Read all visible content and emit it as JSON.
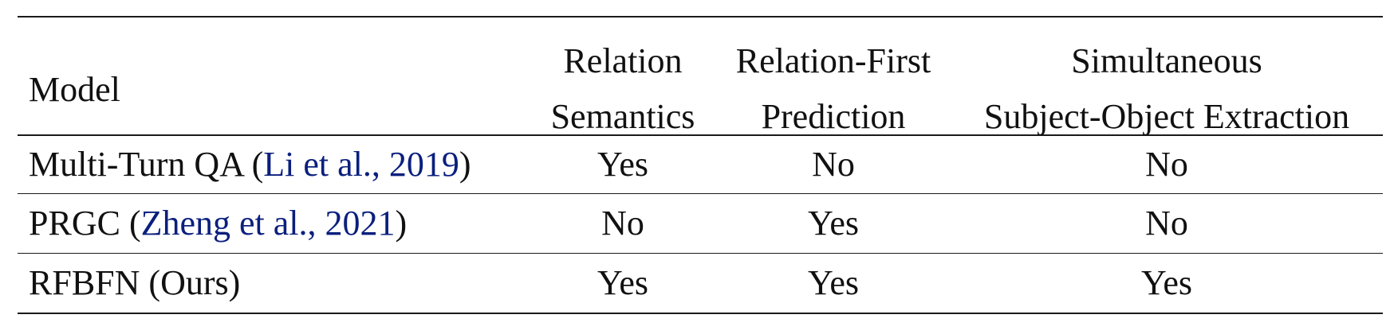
{
  "table": {
    "headers": {
      "model": "Model",
      "relation_semantics": [
        "Relation",
        "Semantics"
      ],
      "relation_first": [
        "Relation-First",
        "Prediction"
      ],
      "simultaneous": [
        "Simultaneous",
        "Subject-Object Extraction"
      ]
    },
    "rows": [
      {
        "model_name": "Multi-Turn QA",
        "citation": "Li et al., 2019",
        "relation_semantics": "Yes",
        "relation_first": "No",
        "simultaneous": "No"
      },
      {
        "model_name": "PRGC",
        "citation": "Zheng et al., 2021",
        "relation_semantics": "No",
        "relation_first": "Yes",
        "simultaneous": "No"
      },
      {
        "model_name": "RFBFN (Ours)",
        "citation": "",
        "relation_semantics": "Yes",
        "relation_first": "Yes",
        "simultaneous": "Yes"
      }
    ],
    "colors": {
      "citation": "#0a1f7d",
      "text": "#111111",
      "rule": "#1a1a1a"
    }
  }
}
